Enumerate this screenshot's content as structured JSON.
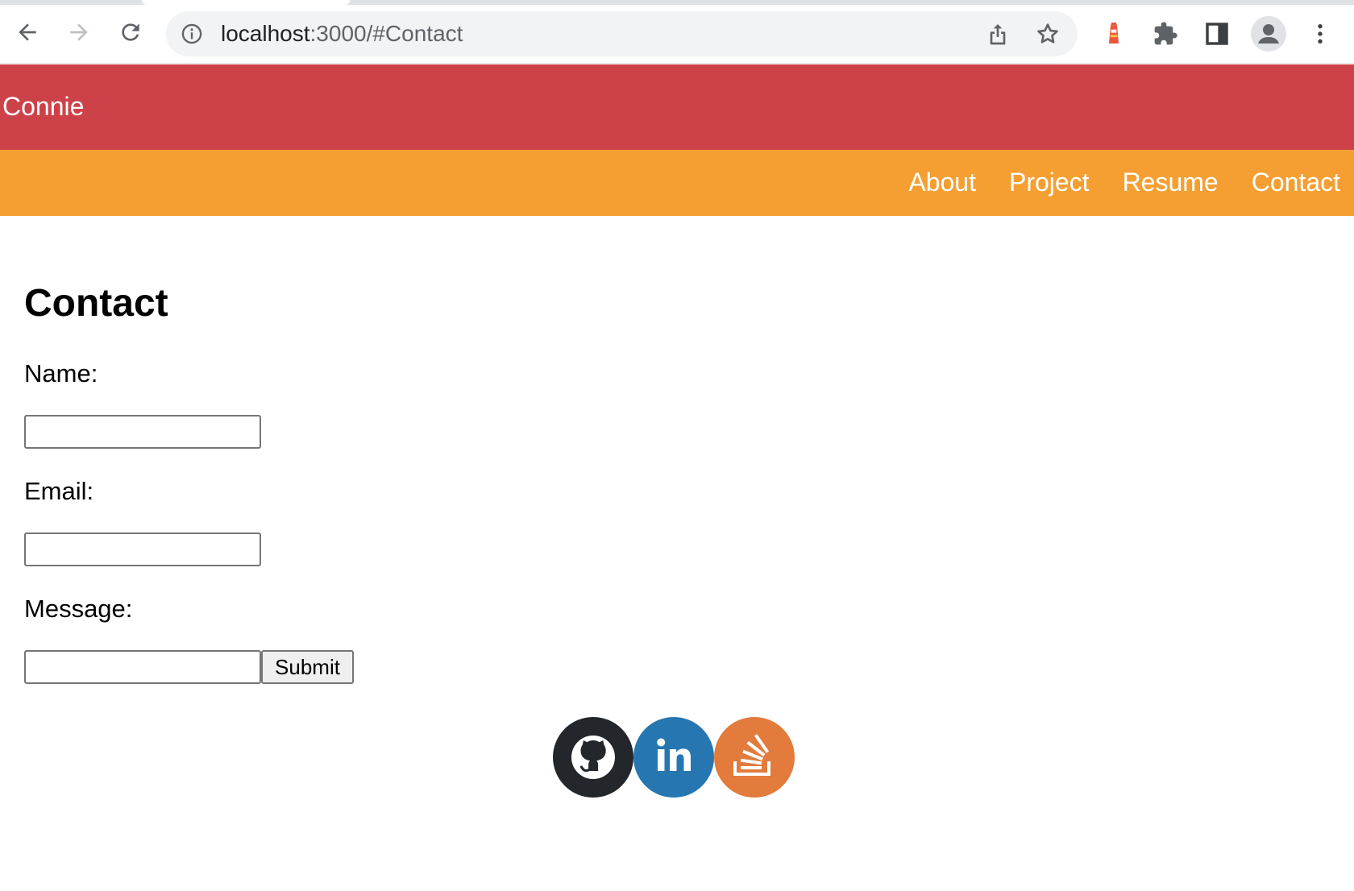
{
  "browser": {
    "url_host": "localhost",
    "url_rest": ":3000/#Contact"
  },
  "site": {
    "title": "Connie",
    "nav": [
      "About",
      "Project",
      "Resume",
      "Contact"
    ]
  },
  "contact": {
    "heading": "Contact",
    "fields": [
      {
        "label": "Name:",
        "value": ""
      },
      {
        "label": "Email:",
        "value": ""
      },
      {
        "label": "Message:",
        "value": ""
      }
    ],
    "submit_label": "Submit"
  },
  "social": [
    "github-icon",
    "linkedin-icon",
    "stackoverflow-icon"
  ],
  "colors": {
    "header": "#cd4249",
    "nav": "#f59f32",
    "github": "#23272b",
    "linkedin": "#2677b1",
    "stackoverflow": "#e27b3c"
  }
}
